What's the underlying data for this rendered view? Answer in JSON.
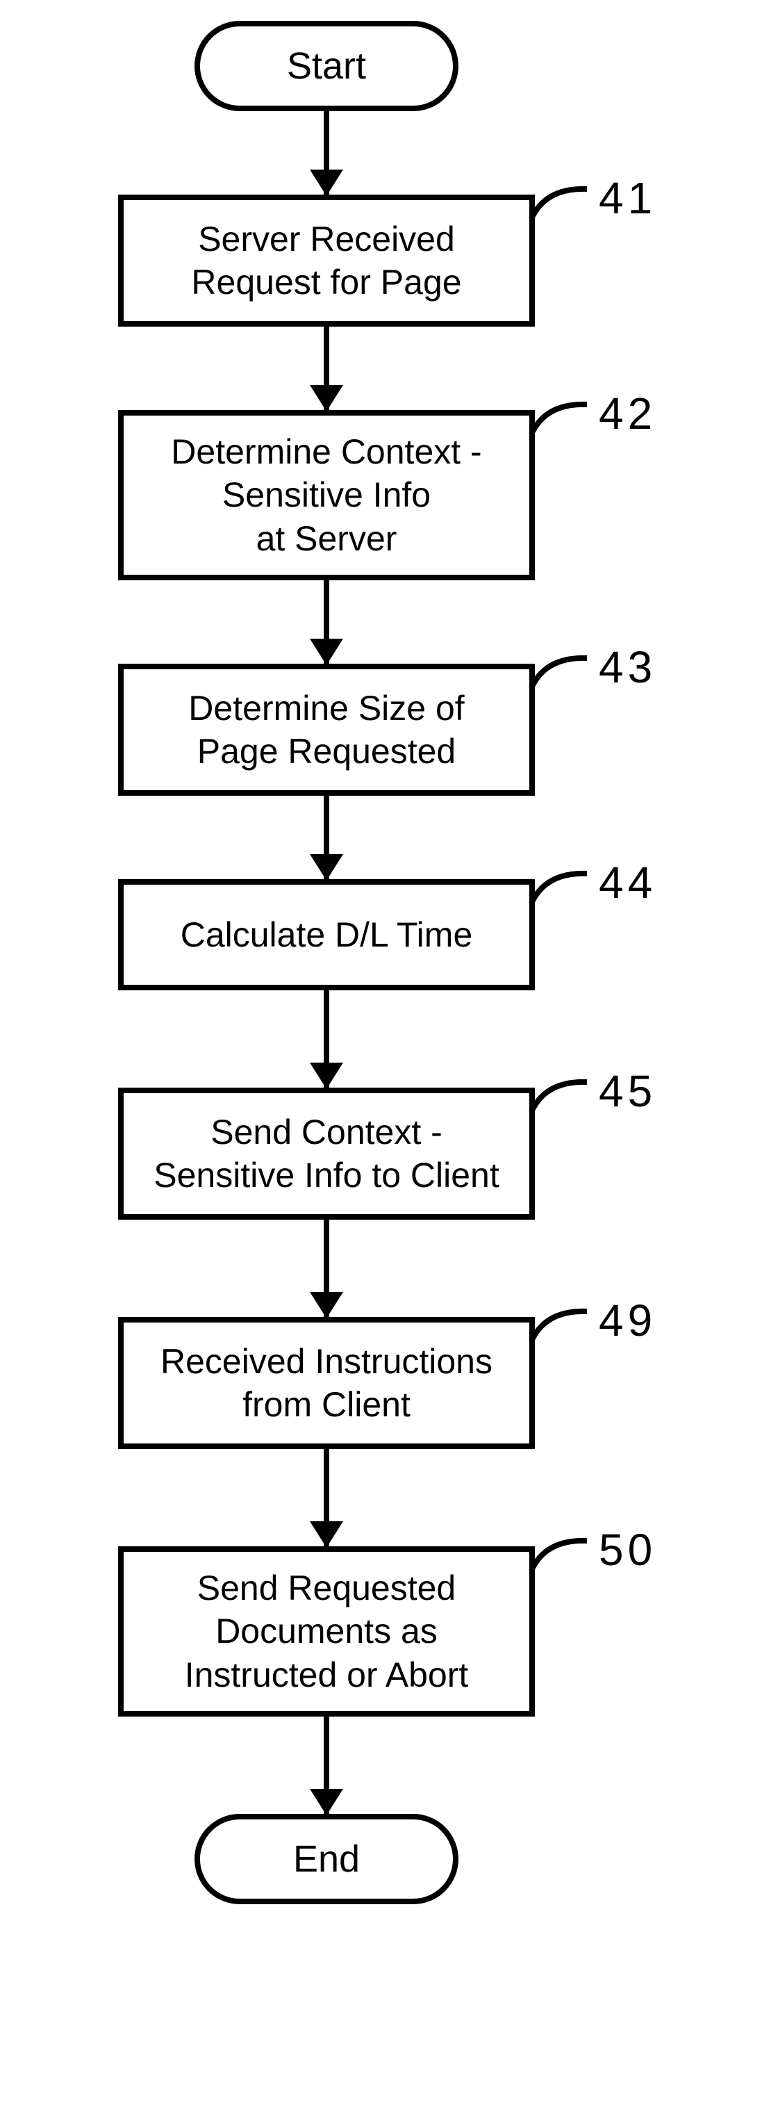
{
  "chart_data": {
    "type": "flowchart",
    "nodes": [
      {
        "id": "start",
        "shape": "terminator",
        "text": "Start"
      },
      {
        "id": "n41",
        "shape": "process",
        "label": "41",
        "text": "Server Received\nRequest for Page"
      },
      {
        "id": "n42",
        "shape": "process",
        "label": "42",
        "text": "Determine Context -\nSensitive Info\nat Server"
      },
      {
        "id": "n43",
        "shape": "process",
        "label": "43",
        "text": "Determine Size of\nPage Requested"
      },
      {
        "id": "n44",
        "shape": "process",
        "label": "44",
        "text": "Calculate D/L Time"
      },
      {
        "id": "n45",
        "shape": "process",
        "label": "45",
        "text": "Send Context -\nSensitive Info to Client"
      },
      {
        "id": "n49",
        "shape": "process",
        "label": "49",
        "text": "Received Instructions\nfrom Client"
      },
      {
        "id": "n50",
        "shape": "process",
        "label": "50",
        "text": "Send Requested\nDocuments as\nInstructed or Abort"
      },
      {
        "id": "end",
        "shape": "terminator",
        "text": "End"
      }
    ],
    "edges": [
      [
        "start",
        "n41"
      ],
      [
        "n41",
        "n42"
      ],
      [
        "n42",
        "n43"
      ],
      [
        "n43",
        "n44"
      ],
      [
        "n44",
        "n45"
      ],
      [
        "n45",
        "n49"
      ],
      [
        "n49",
        "n50"
      ],
      [
        "n50",
        "end"
      ]
    ]
  },
  "start": "Start",
  "end": "End",
  "n41": {
    "label": "41",
    "line1": "Server Received",
    "line2": "Request for Page"
  },
  "n42": {
    "label": "42",
    "line1": "Determine Context -",
    "line2": "Sensitive Info",
    "line3": "at Server"
  },
  "n43": {
    "label": "43",
    "line1": "Determine Size of",
    "line2": "Page Requested"
  },
  "n44": {
    "label": "44",
    "line1": "Calculate D/L Time"
  },
  "n45": {
    "label": "45",
    "line1": "Send Context -",
    "line2": "Sensitive Info to Client"
  },
  "n49": {
    "label": "49",
    "line1": "Received Instructions",
    "line2": "from Client"
  },
  "n50": {
    "label": "50",
    "line1": "Send Requested",
    "line2": "Documents as",
    "line3": "Instructed or Abort"
  }
}
